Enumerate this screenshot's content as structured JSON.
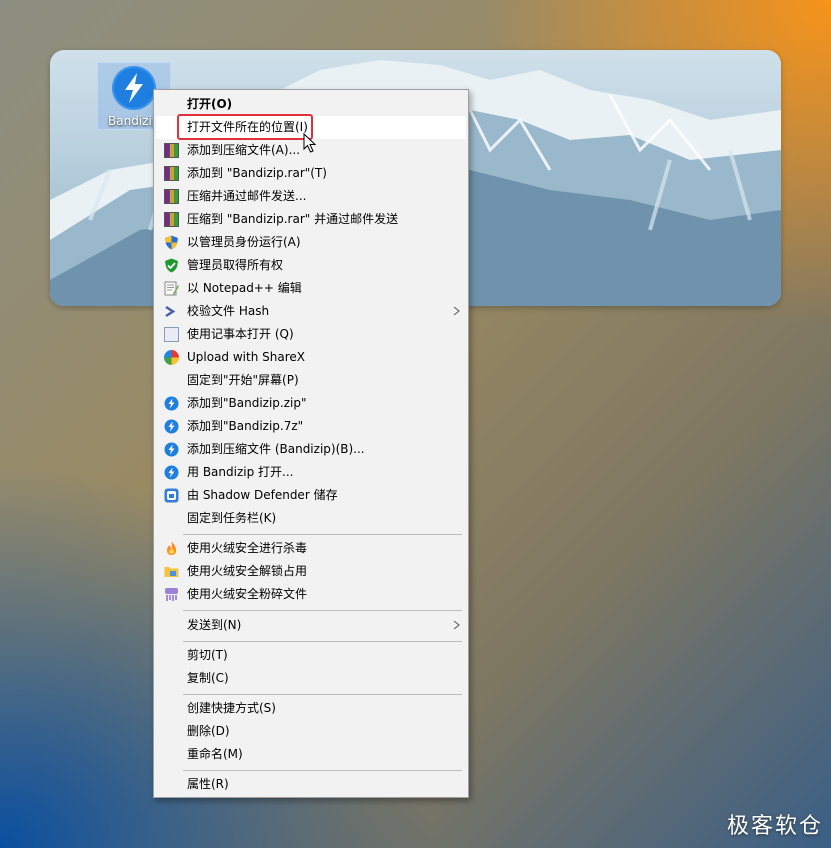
{
  "desktop": {
    "icon_label": "Bandizip"
  },
  "menu": {
    "items": [
      {
        "label": "打开(O)",
        "icon": "none"
      },
      {
        "label": "打开文件所在的位置(I)",
        "icon": "none"
      },
      {
        "label": "添加到压缩文件(A)...",
        "icon": "winrar-icon"
      },
      {
        "label": "添加到 \"Bandizip.rar\"(T)",
        "icon": "winrar-icon"
      },
      {
        "label": "压缩并通过邮件发送...",
        "icon": "winrar-icon"
      },
      {
        "label": "压缩到 \"Bandizip.rar\" 并通过邮件发送",
        "icon": "winrar-icon"
      },
      {
        "label": "以管理员身份运行(A)",
        "icon": "uac-shield-icon"
      },
      {
        "label": "管理员取得所有权",
        "icon": "green-shield-icon"
      },
      {
        "label": "以 Notepad++ 编辑",
        "icon": "notepadpp-icon"
      },
      {
        "label": "校验文件 Hash",
        "icon": "hash-icon"
      },
      {
        "label": "使用记事本打开 (Q)",
        "icon": "notepad-icon"
      },
      {
        "label": "Upload with ShareX",
        "icon": "sharex-icon"
      },
      {
        "label": "固定到\"开始\"屏幕(P)",
        "icon": "none"
      },
      {
        "label": "添加到\"Bandizip.zip\"",
        "icon": "bandizip-icon"
      },
      {
        "label": "添加到\"Bandizip.7z\"",
        "icon": "bandizip-icon"
      },
      {
        "label": "添加到压缩文件 (Bandizip)(B)...",
        "icon": "bandizip-icon"
      },
      {
        "label": "用 Bandizip 打开...",
        "icon": "bandizip-icon"
      },
      {
        "label": "由 Shadow Defender 储存",
        "icon": "shadow-defender-icon"
      },
      {
        "label": "固定到任务栏(K)",
        "icon": "none"
      },
      {
        "label": "使用火绒安全进行杀毒",
        "icon": "huorong-fire-icon"
      },
      {
        "label": "使用火绒安全解锁占用",
        "icon": "folder-unlock-icon"
      },
      {
        "label": "使用火绒安全粉碎文件",
        "icon": "shredder-icon"
      },
      {
        "label": "发送到(N)",
        "icon": "none"
      },
      {
        "label": "剪切(T)",
        "icon": "none"
      },
      {
        "label": "复制(C)",
        "icon": "none"
      },
      {
        "label": "创建快捷方式(S)",
        "icon": "none"
      },
      {
        "label": "删除(D)",
        "icon": "none"
      },
      {
        "label": "重命名(M)",
        "icon": "none"
      },
      {
        "label": "属性(R)",
        "icon": "none"
      }
    ]
  },
  "watermark": "极客软仓"
}
